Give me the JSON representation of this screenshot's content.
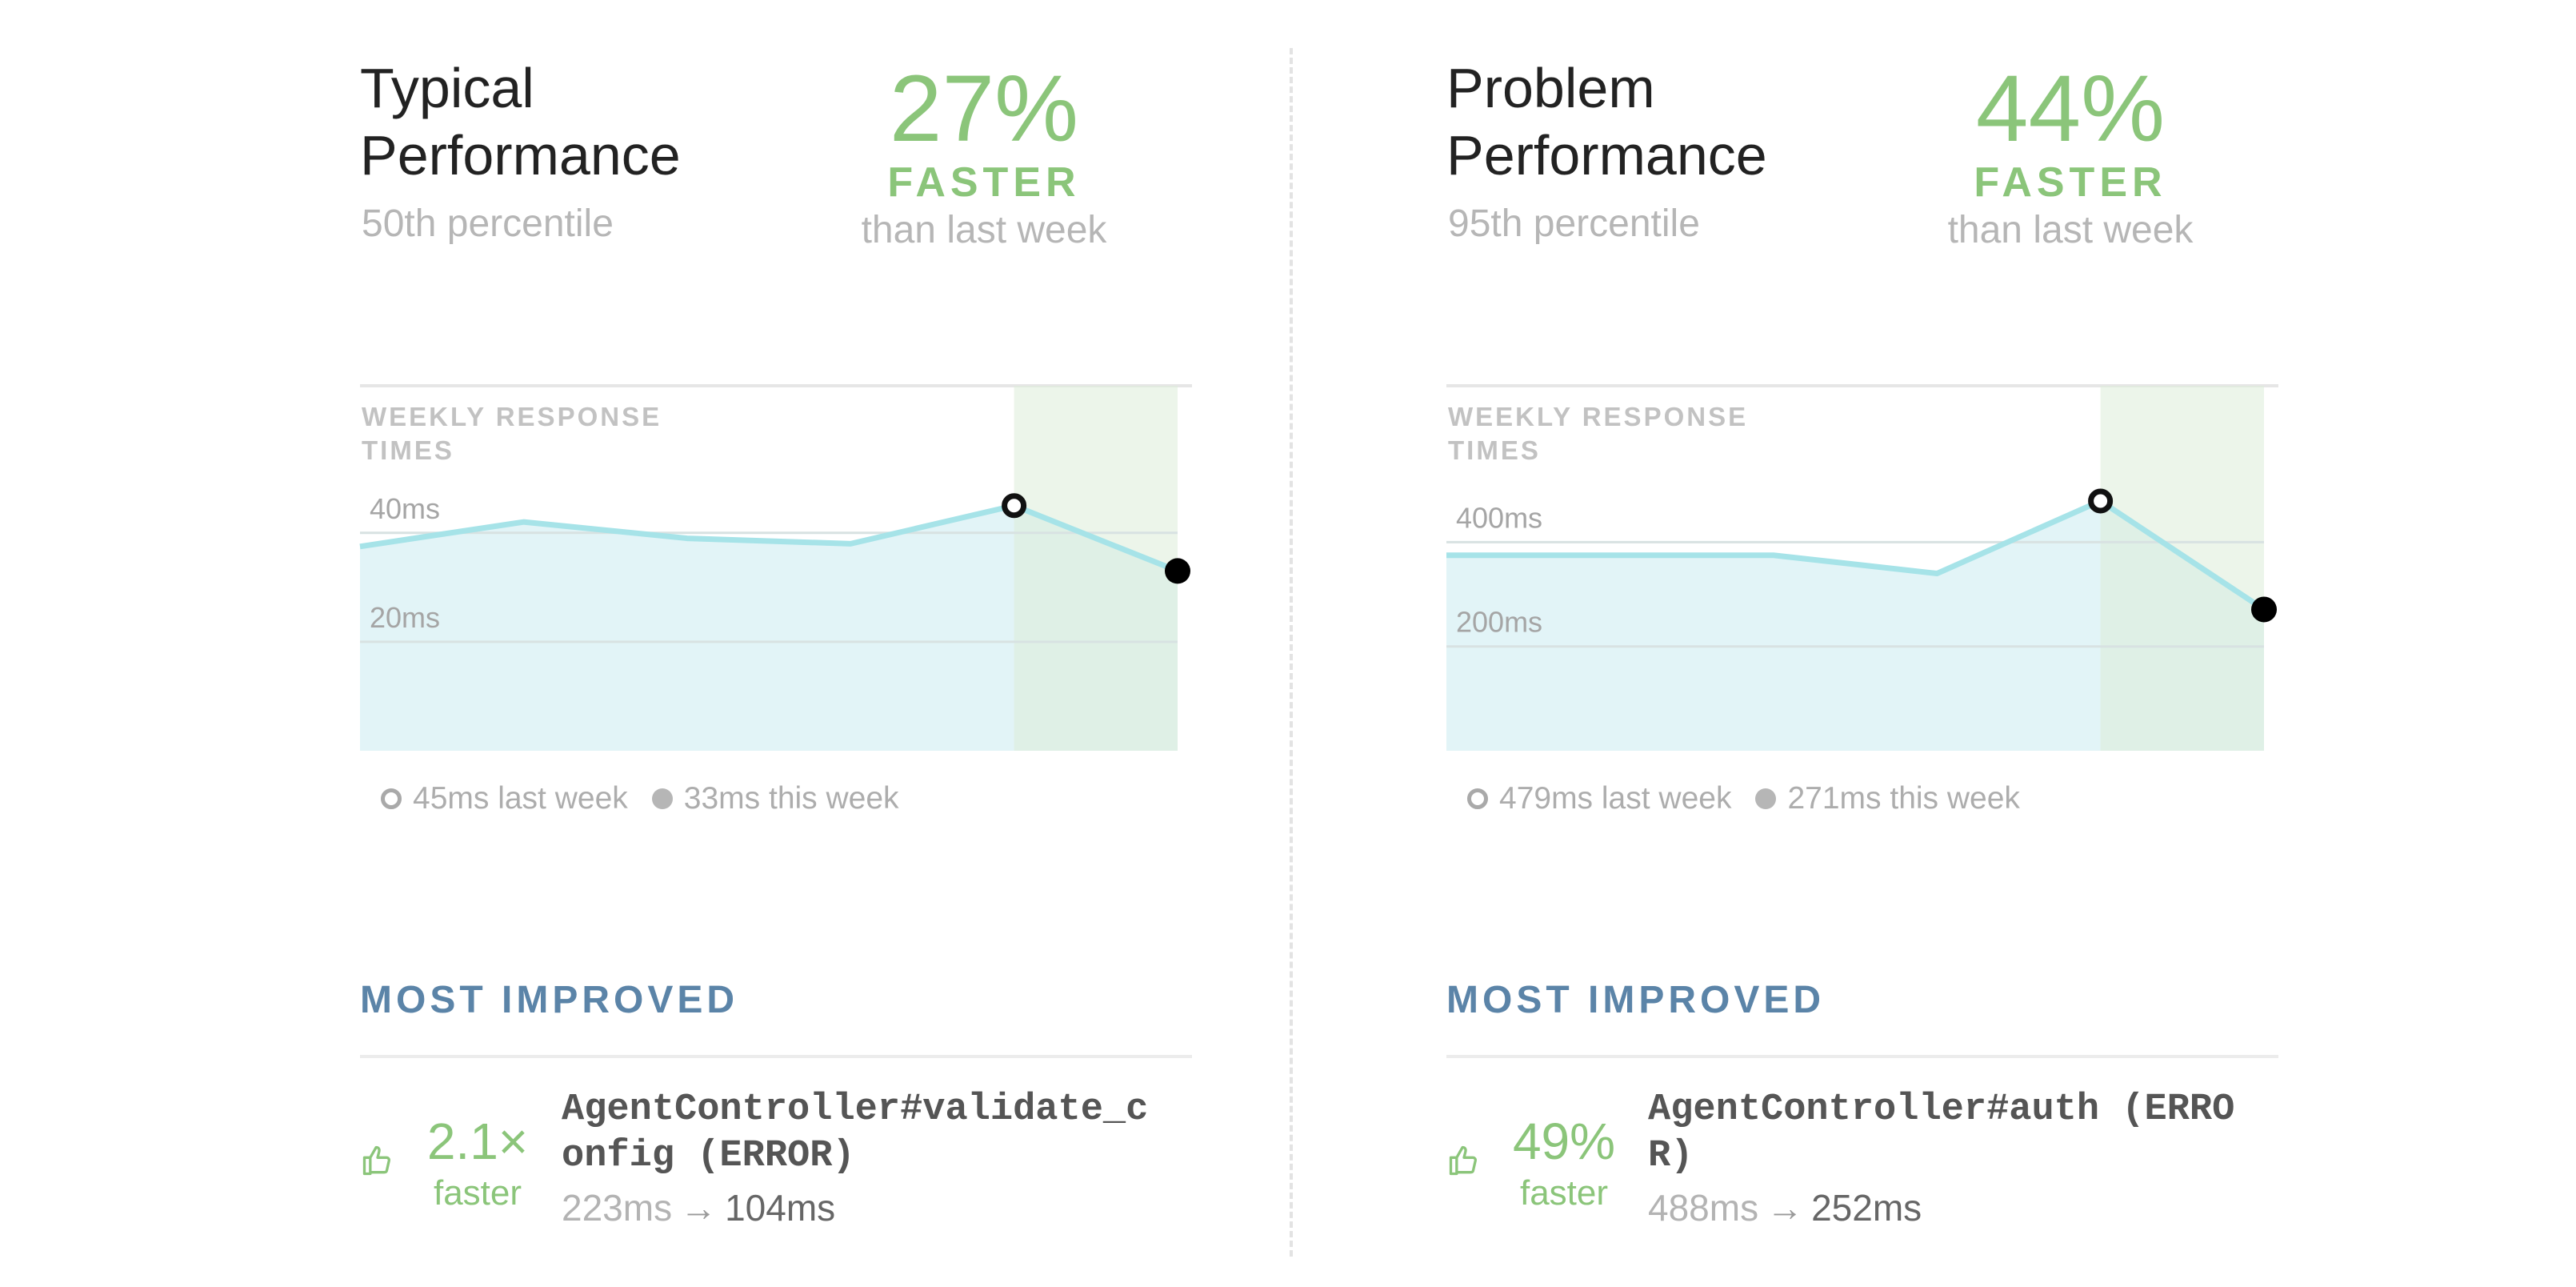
{
  "colors": {
    "accent_green": "#8bc57a",
    "heading_blue": "#5b84a8",
    "line": "#a6e3e8",
    "area": "#e2f4f7",
    "highlight": "#dcecd8",
    "muted_text": "#b6b6b6"
  },
  "panels": [
    {
      "title": "Typical\nPerformance",
      "subtitle": "50th percentile",
      "stat": {
        "value": "27%",
        "label": "FASTER",
        "sub": "than last week"
      },
      "chart_label": "WEEKLY RESPONSE TIMES",
      "legend": {
        "last_week": "45ms last week",
        "this_week": "33ms this week"
      },
      "most_improved": {
        "heading": "MOST IMPROVED",
        "value": "2.1×",
        "faster": "faster",
        "name": "AgentController#validate_config (ERROR)",
        "before": "223ms",
        "arrow": "→",
        "after": "104ms",
        "icon": "thumbs-up-icon"
      }
    },
    {
      "title": "Problem\nPerformance",
      "subtitle": "95th percentile",
      "stat": {
        "value": "44%",
        "label": "FASTER",
        "sub": "than last week"
      },
      "chart_label": "WEEKLY RESPONSE TIMES",
      "legend": {
        "last_week": "479ms last week",
        "this_week": "271ms this week"
      },
      "most_improved": {
        "heading": "MOST IMPROVED",
        "value": "49%",
        "faster": "faster",
        "name": "AgentController#auth (ERROR)",
        "before": "488ms",
        "arrow": "→",
        "after": "252ms",
        "icon": "thumbs-up-icon"
      }
    }
  ],
  "chart_data": [
    {
      "type": "area",
      "title": "WEEKLY RESPONSE TIMES",
      "units": "ms",
      "x": [
        1,
        2,
        3,
        4,
        5,
        6
      ],
      "values": [
        37.5,
        42,
        39,
        38,
        45,
        33
      ],
      "last_week_index": 4,
      "this_week_index": 5,
      "ylim": [
        0,
        67
      ],
      "yticks": [
        20,
        40
      ],
      "ytick_labels": [
        "20ms",
        "40ms"
      ],
      "grid": true,
      "legend_placement": "bottom-left"
    },
    {
      "type": "area",
      "title": "WEEKLY RESPONSE TIMES",
      "units": "ms",
      "x": [
        1,
        2,
        3,
        4,
        5,
        6
      ],
      "values": [
        375,
        375,
        375,
        340,
        479,
        271
      ],
      "last_week_index": 4,
      "this_week_index": 5,
      "ylim": [
        0,
        700
      ],
      "yticks": [
        200,
        400
      ],
      "ytick_labels": [
        "200ms",
        "400ms"
      ],
      "grid": true,
      "legend_placement": "bottom-left"
    }
  ]
}
